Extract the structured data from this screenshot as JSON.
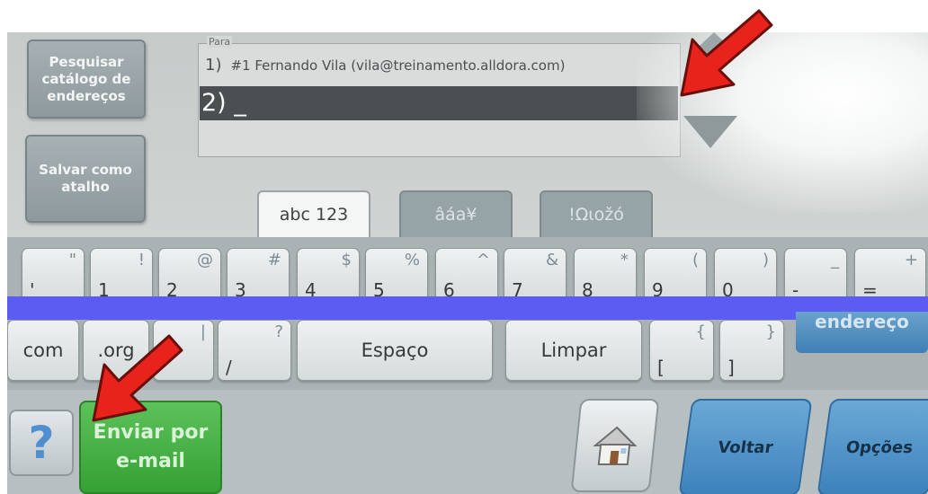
{
  "sidebar": {
    "search_label": "Pesquisar catálogo de endereços",
    "save_label": "Salvar como atalho"
  },
  "to_field": {
    "label": "Para",
    "entries": [
      {
        "num": "1)",
        "text": "#1 Fernando Vila (vila@treinamento.alldora.com)"
      },
      {
        "num": "2)",
        "text": "_"
      }
    ]
  },
  "tabs": [
    {
      "label": "abc 123",
      "state": "active"
    },
    {
      "label": "âáa¥",
      "state": "inactive"
    },
    {
      "label": "!Ωιοžó",
      "state": "inactive"
    }
  ],
  "keyboard": {
    "row1": [
      {
        "lo": "'",
        "hi": "\""
      },
      {
        "lo": "1",
        "hi": "!"
      },
      {
        "lo": "2",
        "hi": "@"
      },
      {
        "lo": "3",
        "hi": "#"
      },
      {
        "lo": "4",
        "hi": "$"
      },
      {
        "lo": "5",
        "hi": "%"
      },
      {
        "lo": "6",
        "hi": "^"
      },
      {
        "lo": "7",
        "hi": "&"
      },
      {
        "lo": "8",
        "hi": "*"
      },
      {
        "lo": "9",
        "hi": "("
      },
      {
        "lo": "0",
        "hi": ")"
      },
      {
        "lo": "-",
        "hi": "_"
      },
      {
        "lo": "=",
        "hi": "+"
      }
    ],
    "row2": {
      "com": "com",
      "org": ".org",
      "pipe_hi": "|",
      "slash_lo": "/",
      "slash_hi": "?",
      "space": "Espaço",
      "clear": "Limpar",
      "bracket_open_lo": "[",
      "bracket_open_hi": "{",
      "bracket_close_lo": "]",
      "bracket_close_hi": "}",
      "address": "endereço"
    }
  },
  "bottom": {
    "help": "?",
    "send": "Enviar por e-mail",
    "back": "Voltar",
    "options": "Opções"
  },
  "colors": {
    "accent_blue": "#3e82bc",
    "send_green": "#35a034",
    "highlight_bar": "#5b5cf2",
    "arrow_red": "#e8231c"
  }
}
